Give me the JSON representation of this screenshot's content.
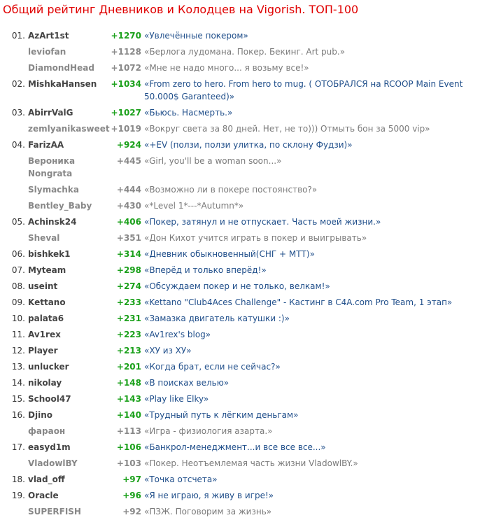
{
  "page": {
    "title": "Общий рейтинг Дневников и Колодцев на Vigorish. ТОП-100"
  },
  "rows": [
    {
      "rank": "01.",
      "name": "AzArt1st",
      "score": "+1270",
      "desc": "«Увлечённые покером»",
      "type": "diary"
    },
    {
      "rank": "",
      "name": "leviofan",
      "score": "+1128",
      "desc": "«Берлога лудомана. Покер. Бекинг. Art pub.»",
      "type": "well"
    },
    {
      "rank": "",
      "name": "DiamondHead",
      "score": "+1072",
      "desc": "«Мне не надо много... я возьму все!»",
      "type": "well"
    },
    {
      "rank": "02.",
      "name": "MishkaHansen",
      "score": "+1034",
      "desc": "«From zero to hero. From hero to mug. ( ОТОБРАЛСЯ на RCOOP Main Event 50.000$ Garanteed)»",
      "type": "diary"
    },
    {
      "rank": "03.",
      "name": "AbirrValG",
      "score": "+1027",
      "desc": "«Бьюсь. Насмерть.»",
      "type": "diary"
    },
    {
      "rank": "",
      "name": "zemlyanikasweet",
      "score": "+1019",
      "desc": "«Вокруг света за 80 дней. Нет, не то))) Отмыть бон за 5000 vip»",
      "type": "well"
    },
    {
      "rank": "04.",
      "name": "FarizAA",
      "score": "+924",
      "desc": "«+EV (ползи, ползи улитка, по склону Фудзи)»",
      "type": "diary"
    },
    {
      "rank": "",
      "name": "Вероника Nongrata",
      "score": "+445",
      "desc": "«Girl, you'll be a woman soon...»",
      "type": "well"
    },
    {
      "rank": "",
      "name": "Slymachka",
      "score": "+444",
      "desc": "«Возможно ли в покере постоянство?»",
      "type": "well"
    },
    {
      "rank": "",
      "name": "Bentley_Baby",
      "score": "+430",
      "desc": "«*Level 1*---*Autumn*»",
      "type": "well"
    },
    {
      "rank": "05.",
      "name": "Achinsk24",
      "score": "+406",
      "desc": "«Покер, затянул и не отпускает. Часть моей жизни.»",
      "type": "diary"
    },
    {
      "rank": "",
      "name": "Sheval",
      "score": "+351",
      "desc": "«Дон Кихот учится играть в покер и выигрывать»",
      "type": "well"
    },
    {
      "rank": "06.",
      "name": "bishkek1",
      "score": "+314",
      "desc": "«Дневник обыкновенный(СНГ + МТТ)»",
      "type": "diary"
    },
    {
      "rank": "07.",
      "name": "Myteam",
      "score": "+298",
      "desc": "«Вперёд и только вперёд!»",
      "type": "diary"
    },
    {
      "rank": "08.",
      "name": "useint",
      "score": "+274",
      "desc": "«Обсуждаем покер и не только, велкам!»",
      "type": "diary"
    },
    {
      "rank": "09.",
      "name": "Kettano",
      "score": "+233",
      "desc": "«Kettano \"Club4Aces Challenge\" - Кастинг в C4A.com Pro Team, 1 этап»",
      "type": "diary"
    },
    {
      "rank": "10.",
      "name": "palata6",
      "score": "+231",
      "desc": "«Замазка двигатель катушки :)»",
      "type": "diary"
    },
    {
      "rank": "11.",
      "name": "Av1rex",
      "score": "+223",
      "desc": "«Av1rex's blog»",
      "type": "diary"
    },
    {
      "rank": "12.",
      "name": "Player",
      "score": "+213",
      "desc": "«ХУ из ХУ»",
      "type": "diary"
    },
    {
      "rank": "13.",
      "name": "unlucker",
      "score": "+201",
      "desc": "«Когда брат, если не сейчас?»",
      "type": "diary"
    },
    {
      "rank": "14.",
      "name": "nikolay",
      "score": "+148",
      "desc": "«В поисках велью»",
      "type": "diary"
    },
    {
      "rank": "15.",
      "name": "School47",
      "score": "+143",
      "desc": "«Play like Elky»",
      "type": "diary"
    },
    {
      "rank": "16.",
      "name": "Djino",
      "score": "+140",
      "desc": "«Трудный путь к лёгким деньгам»",
      "type": "diary"
    },
    {
      "rank": "",
      "name": "фараон",
      "score": "+113",
      "desc": "«Игра - физиология азарта.»",
      "type": "well"
    },
    {
      "rank": "17.",
      "name": "easyd1m",
      "score": "+106",
      "desc": "«Банкрол-менеджмент...и все все все...»",
      "type": "diary"
    },
    {
      "rank": "",
      "name": "VladowlBY",
      "score": "+103",
      "desc": "«Покер. Неотъемлемая часть жизни VladowlBY.»",
      "type": "well"
    },
    {
      "rank": "18.",
      "name": "vlad_off",
      "score": "+97",
      "desc": "«Точка отсчета»",
      "type": "diary"
    },
    {
      "rank": "19.",
      "name": "Oracle",
      "score": "+96",
      "desc": "«Я не играю, я живу в игре!»",
      "type": "diary"
    },
    {
      "rank": "",
      "name": "SUPERFISH",
      "score": "+92",
      "desc": "«ПЗЖ. Поговорим за жизнь»",
      "type": "well"
    }
  ]
}
